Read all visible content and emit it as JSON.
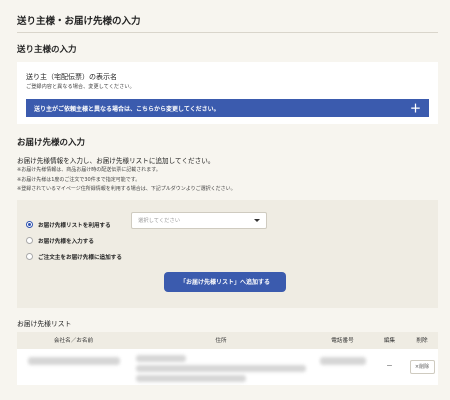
{
  "page_title": "送り主様・お届け先様の入力",
  "sender": {
    "section_title": "送り主様の入力",
    "label": "送り主（宅配伝票）の表示名",
    "note": "ご登録内容と異なる場合、変更してください。",
    "bar_label": "送り主がご依頼主様と異なる場合は、こちらから変更してください。",
    "bar_icon": "plus-icon"
  },
  "destination": {
    "section_title": "お届け先様の入力",
    "description": "お届け先様情報を入力し、お届け先様リストに追加してください。",
    "notes": [
      "※お届け先様情報は、商品お届け時の配送伝票に記載されます。",
      "※お届け先様は1度のご注文で30件まで指定可能です。",
      "※登録されているマイページ住所録情報を利用する場合は、下記プルダウンよりご選択ください。"
    ],
    "options": [
      {
        "label": "お届け先様リストを利用する",
        "checked": true
      },
      {
        "label": "お届け先様を入力する",
        "checked": false
      },
      {
        "label": "ご注文主をお届け先様に追加する",
        "checked": false
      }
    ],
    "select_placeholder": "選択してください",
    "add_button": "「お届け先様リスト」へ追加する"
  },
  "list": {
    "title": "お届け先様リスト",
    "headers": [
      "会社名／お名前",
      "住所",
      "電話番号",
      "編集",
      "削除"
    ],
    "row": {
      "edit": "ー",
      "delete": "×削除"
    }
  },
  "colors": {
    "accent": "#3b5bae",
    "background": "#f7f5ef",
    "panel": "#efece3"
  }
}
